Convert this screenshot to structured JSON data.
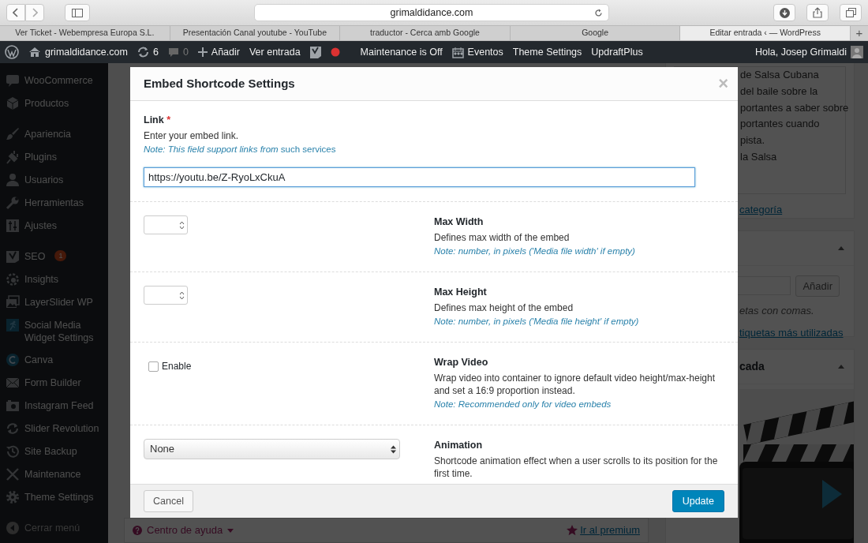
{
  "browser": {
    "address": "grimaldidance.com",
    "tabs": [
      {
        "label": "Ver Ticket - Webempresa Europa S.L.",
        "selected": false
      },
      {
        "label": "Presentación Canal youtube - YouTube",
        "selected": false
      },
      {
        "label": "traductor - Cerca amb Google",
        "selected": false
      },
      {
        "label": "Google",
        "selected": false
      },
      {
        "label": "Editar entrada ‹ — WordPress",
        "selected": true
      }
    ],
    "new_tab": "+"
  },
  "admin_bar": {
    "site": "grimaldidance.com",
    "updates": "6",
    "comments": "0",
    "add": "Añadir",
    "view": "Ver entrada",
    "maintenance": "Maintenance is Off",
    "events": "Eventos",
    "theme_settings": "Theme Settings",
    "backup": "UpdraftPlus",
    "greeting": "Hola, Josep Grimaldi"
  },
  "sidebar": {
    "groups": [
      [
        {
          "label": "WooCommerce"
        },
        {
          "label": "Productos"
        }
      ],
      [
        {
          "label": "Apariencia"
        },
        {
          "label": "Plugins"
        },
        {
          "label": "Usuarios"
        },
        {
          "label": "Herramientas"
        },
        {
          "label": "Ajustes"
        }
      ],
      [
        {
          "label": "SEO",
          "badge": "1"
        },
        {
          "label": "Insights"
        },
        {
          "label": "LayerSlider WP"
        },
        {
          "label": "Social Media Widget Settings"
        },
        {
          "label": "Canva"
        },
        {
          "label": "Form Builder"
        },
        {
          "label": "Instagram Feed"
        },
        {
          "label": "Slider Revolution"
        },
        {
          "label": "Site Backup"
        },
        {
          "label": "Maintenance"
        },
        {
          "label": "Theme Settings"
        }
      ]
    ],
    "collapse": "Cerrar menú"
  },
  "right_panel": {
    "category_lines": [
      "de Salsa Cubana",
      "del baile sobre la",
      "portantes a saber sobre",
      "portantes cuando",
      "pista.",
      "la Salsa"
    ],
    "category_link": "categoría",
    "tags_button": "Añadir",
    "tags_hint": "etas con comas.",
    "tags_link": "tiquetas más utilizadas",
    "image_title": "cada"
  },
  "editor_footer": {
    "help": "Centro de ayuda",
    "premium": "Ir al premium"
  },
  "modal": {
    "title": "Embed Shortcode Settings",
    "close": "×",
    "link": {
      "label": "Link",
      "required": "*",
      "description": "Enter your embed link.",
      "note": "Note: This field support links from ",
      "note_link": "such services",
      "value": "https://youtu.be/Z-RyoLxCkuA"
    },
    "rows": [
      {
        "kind": "number",
        "label": "Max Width",
        "description": "Defines max width of the embed",
        "note": "Note: number, in pixels ('Media file width' if empty)"
      },
      {
        "kind": "number",
        "label": "Max Height",
        "description": "Defines max height of the embed",
        "note": "Note: number, in pixels ('Media file height' if empty)"
      },
      {
        "kind": "checkbox",
        "control_label": "Enable",
        "checked": false,
        "label": "Wrap Video",
        "description": "Wrap video into container to ignore default video height/max-height and set a 16:9 proportion instead.",
        "note": "Note: Recommended only for video embeds"
      },
      {
        "kind": "select",
        "value": "None",
        "label": "Animation",
        "description": "Shortcode animation effect when a user scrolls to its position for the first time."
      }
    ],
    "cancel": "Cancel",
    "update": "Update"
  }
}
